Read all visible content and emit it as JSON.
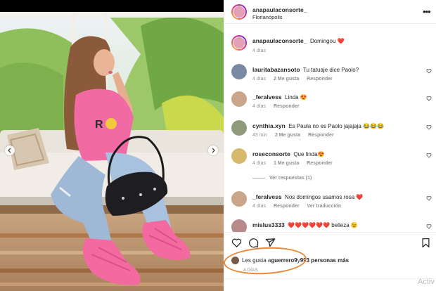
{
  "post": {
    "username": "anapaulaconsorte_",
    "location": "Florianópolis",
    "caption": {
      "username": "anapaulaconsorte_",
      "text": "Domingou ❤️",
      "age": "4 días"
    }
  },
  "comments": [
    {
      "username": "lauritabazansoto",
      "text": "Tu tatuaje dice Paolo?",
      "age": "4 días",
      "likes": "2 Me gusta",
      "reply": "Responder",
      "avatar_color": "#7b8aa3"
    },
    {
      "username": "_feralvess",
      "text": "Linda 😍",
      "age": "4 días",
      "likes": "",
      "reply": "Responder",
      "avatar_color": "#c9a58a"
    },
    {
      "username": "cynthia.xyn",
      "text": "Es Paula no es Paolo jajajaja 😂😂😂",
      "age": "43 min",
      "likes": "2 Me gusta",
      "reply": "Responder",
      "avatar_color": "#8f9a7a"
    },
    {
      "username": "roseconsorte",
      "text": "Que linda😍",
      "age": "4 días",
      "likes": "1 Me gusta",
      "reply": "Responder",
      "avatar_color": "#d6b96b"
    },
    {
      "username": "_feralvess",
      "text": "Nos domingos usamos rosa ❤️",
      "age": "4 días",
      "likes": "",
      "reply": "Responder",
      "extra": "Ver traducción",
      "avatar_color": "#c9a58a"
    },
    {
      "username": "mislus3333",
      "text": "❤️❤️❤️❤️❤️❤️ belleza 😉",
      "age": "",
      "likes": "",
      "reply": "",
      "avatar_color": "#b98a8a"
    }
  ],
  "view_replies": "Ver respuestas (1)",
  "likes_line": {
    "prefix": "Les gusta a ",
    "user": "guerrero9",
    "middle": " y ",
    "count": "993 personas más"
  },
  "date": "4 DÍAS",
  "watermark": "Activ",
  "colors": {
    "accent_oval": "#e8893a",
    "muted": "#8e8e8e",
    "text": "#262626"
  },
  "icons": [
    "more-icon",
    "heart-icon",
    "comment-icon",
    "share-icon",
    "bookmark-icon",
    "chevron-left-icon",
    "chevron-right-icon"
  ]
}
